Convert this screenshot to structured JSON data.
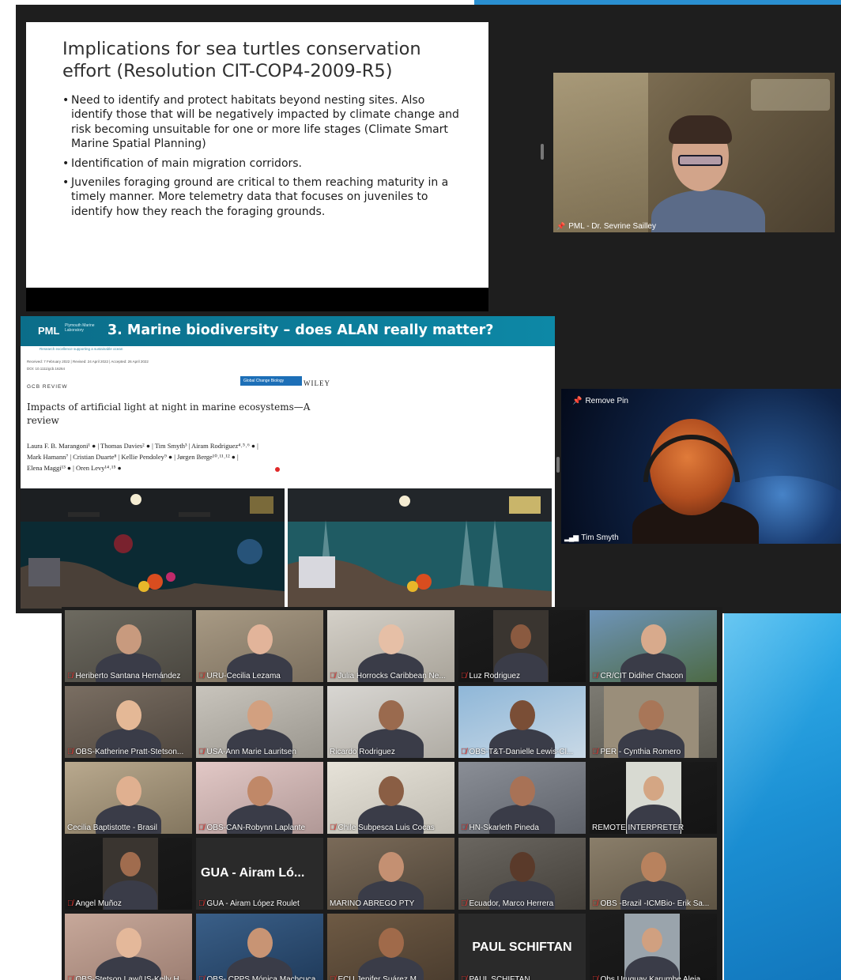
{
  "slide1": {
    "title": "Implications for sea turtles conservation effort (Resolution CIT-COP4-2009-R5)",
    "bullets": [
      "Need to identify and protect habitats beyond nesting sites. Also identify those that will be negatively impacted by climate change and risk becoming unsuitable for one or more life stages (Climate Smart Marine Spatial Planning)",
      "Identification of main migration corridors.",
      "Juveniles foraging ground are critical to them reaching maturity in a timely manner. More telemetry data that focuses on juveniles to identify how they reach the foraging grounds."
    ]
  },
  "speakers": {
    "speaker1": {
      "label": "PML - Dr. Sevrine Sailley"
    },
    "speaker2": {
      "label": "Tim Smyth",
      "remove_pin": "Remove Pin"
    }
  },
  "slide2": {
    "logo": "PML",
    "logo_sub": "Plymouth Marine Laboratory",
    "title": "3. Marine biodiversity – does ALAN really matter?",
    "tagline": "Research excellence supporting a sustainable ocean",
    "dates": "Received: 7 February 2022  |  Revised: 24 April 2022  |  Accepted: 26 April 2022",
    "doi": "DOI: 10.1111/gcb.16264",
    "section": "GCB REVIEW",
    "journal": "Global Change Biology",
    "publisher": "WILEY",
    "article_title": "Impacts of artificial light at night in marine ecosystems—A review",
    "authors": [
      "Laura F. B. Marangoni¹ ●  |  Thomas Davies² ●  |  Tim Smyth³  |  Airam Rodriguez⁴˒⁵˒⁶ ●  |",
      "Mark Hamann⁷  |  Cristian Duarte⁸  |  Kellie Pendoley⁹ ●  |  Jørgen Berge¹⁰˒¹¹˒¹² ●  |",
      "Elena Maggi¹³ ●  |  Oren Levy¹⁴˒¹⁵ ●"
    ]
  },
  "participants": [
    "Heriberto Santana Hernández",
    "URU-Cecilia Lezama",
    "Julia Horrocks Caribbean Ne...",
    "Luz Rodriguez",
    "CR/CIT Didiher Chacon",
    "OBS-Katherine Pratt-Stetson...",
    "USA-Ann Marie Lauritsen",
    "Ricardo Rodriguez",
    "OBS-T&T-Danielle Lewis-Cl...",
    "PER - Cynthia Romero",
    "Cecilia Baptistotte - Brasil",
    "OBS-CAN-Robynn Laplante",
    "Chile Subpesca Luis Cocas",
    "HN-Skarleth Pineda",
    "REMOTE INTERPRETER",
    "Angel Muñoz",
    "GUA - Airam López Roulet",
    "MARINO ABREGO PTY",
    "Ecuador, Marco Herrera",
    "OBS -Brazil -ICMBio- Erik Sa...",
    "OBS-Stetson Law/US-Kelly H...",
    "OBS- CPPS Mónica Machcuca",
    "ECU Jenifer Suárez M",
    "PAUL SCHIFTAN",
    "Obs Uruguay Karumbe Aleja..."
  ],
  "placeholders": {
    "airam": "GUA - Airam Ló...",
    "paul": "PAUL SCHIFTAN"
  },
  "colors": {
    "slide2_header": "#0b6d89",
    "mic_off": "#e53935",
    "background_accent": "#1b8fd3"
  }
}
